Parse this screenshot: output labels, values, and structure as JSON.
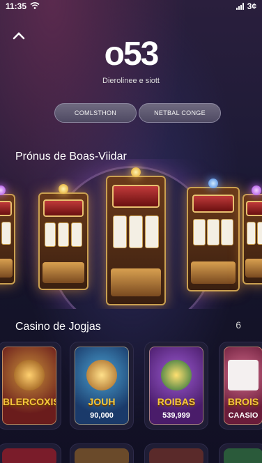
{
  "status_bar": {
    "time": "11:35",
    "battery": "3¢"
  },
  "header": {
    "logo": "o53",
    "tagline": "Dierolinee e siott"
  },
  "buttons": {
    "left": "COMLSTHON",
    "right": "NETBAL CONGE"
  },
  "bonus_section": {
    "title": "Prónus de Boas-Viidar"
  },
  "casino_section": {
    "title": "Casino de Jogjas",
    "extra": "6"
  },
  "games": [
    {
      "name": "BLERCOXIS",
      "value": "",
      "accent": "#6a1c1c"
    },
    {
      "name": "JOUH",
      "value": "90,000",
      "accent": "#1a3a6a"
    },
    {
      "name": "ROIBAS",
      "value": "539,999",
      "accent": "#4a1c6a"
    },
    {
      "name": "BROIS",
      "value": "CAASIO",
      "accent": "#6a1c3a"
    }
  ],
  "icons": {
    "back": "chevron-up-icon",
    "wifi": "wifi-icon",
    "signal": "signal-icon"
  }
}
